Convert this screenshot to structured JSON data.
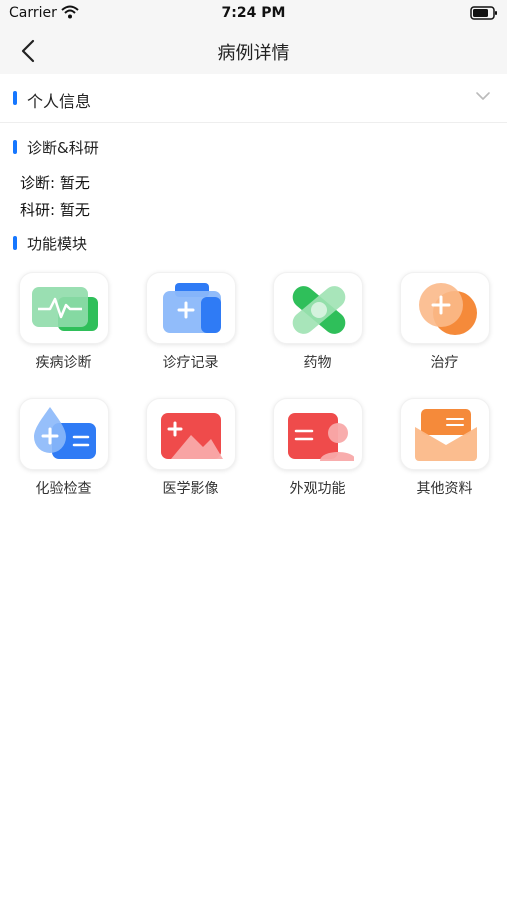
{
  "status_bar": {
    "carrier": "Carrier",
    "time": "7:24 PM"
  },
  "nav": {
    "title": "病例详情"
  },
  "sections": {
    "personal": "个人信息",
    "diagnosis": "诊断&科研",
    "modules": "功能模块"
  },
  "fields": {
    "diagnosis": "诊断: 暂无",
    "research": "科研: 暂无"
  },
  "modules": [
    {
      "label": "疾病诊断",
      "icon": "heartbeat-monitor-icon"
    },
    {
      "label": "诊疗记录",
      "icon": "medical-kit-icon"
    },
    {
      "label": "药物",
      "icon": "bandage-icon"
    },
    {
      "label": "治疗",
      "icon": "medical-cross-icon"
    },
    {
      "label": "化验检查",
      "icon": "blood-test-icon"
    },
    {
      "label": "医学影像",
      "icon": "medical-image-icon"
    },
    {
      "label": "外观功能",
      "icon": "appearance-card-icon"
    },
    {
      "label": "其他资料",
      "icon": "document-envelope-icon"
    }
  ],
  "colors": {
    "accent": "#1677ff",
    "green": "#2fbf5a",
    "blue": "#2f7bf5",
    "orange": "#f58a3a",
    "red": "#ef4b4b"
  }
}
